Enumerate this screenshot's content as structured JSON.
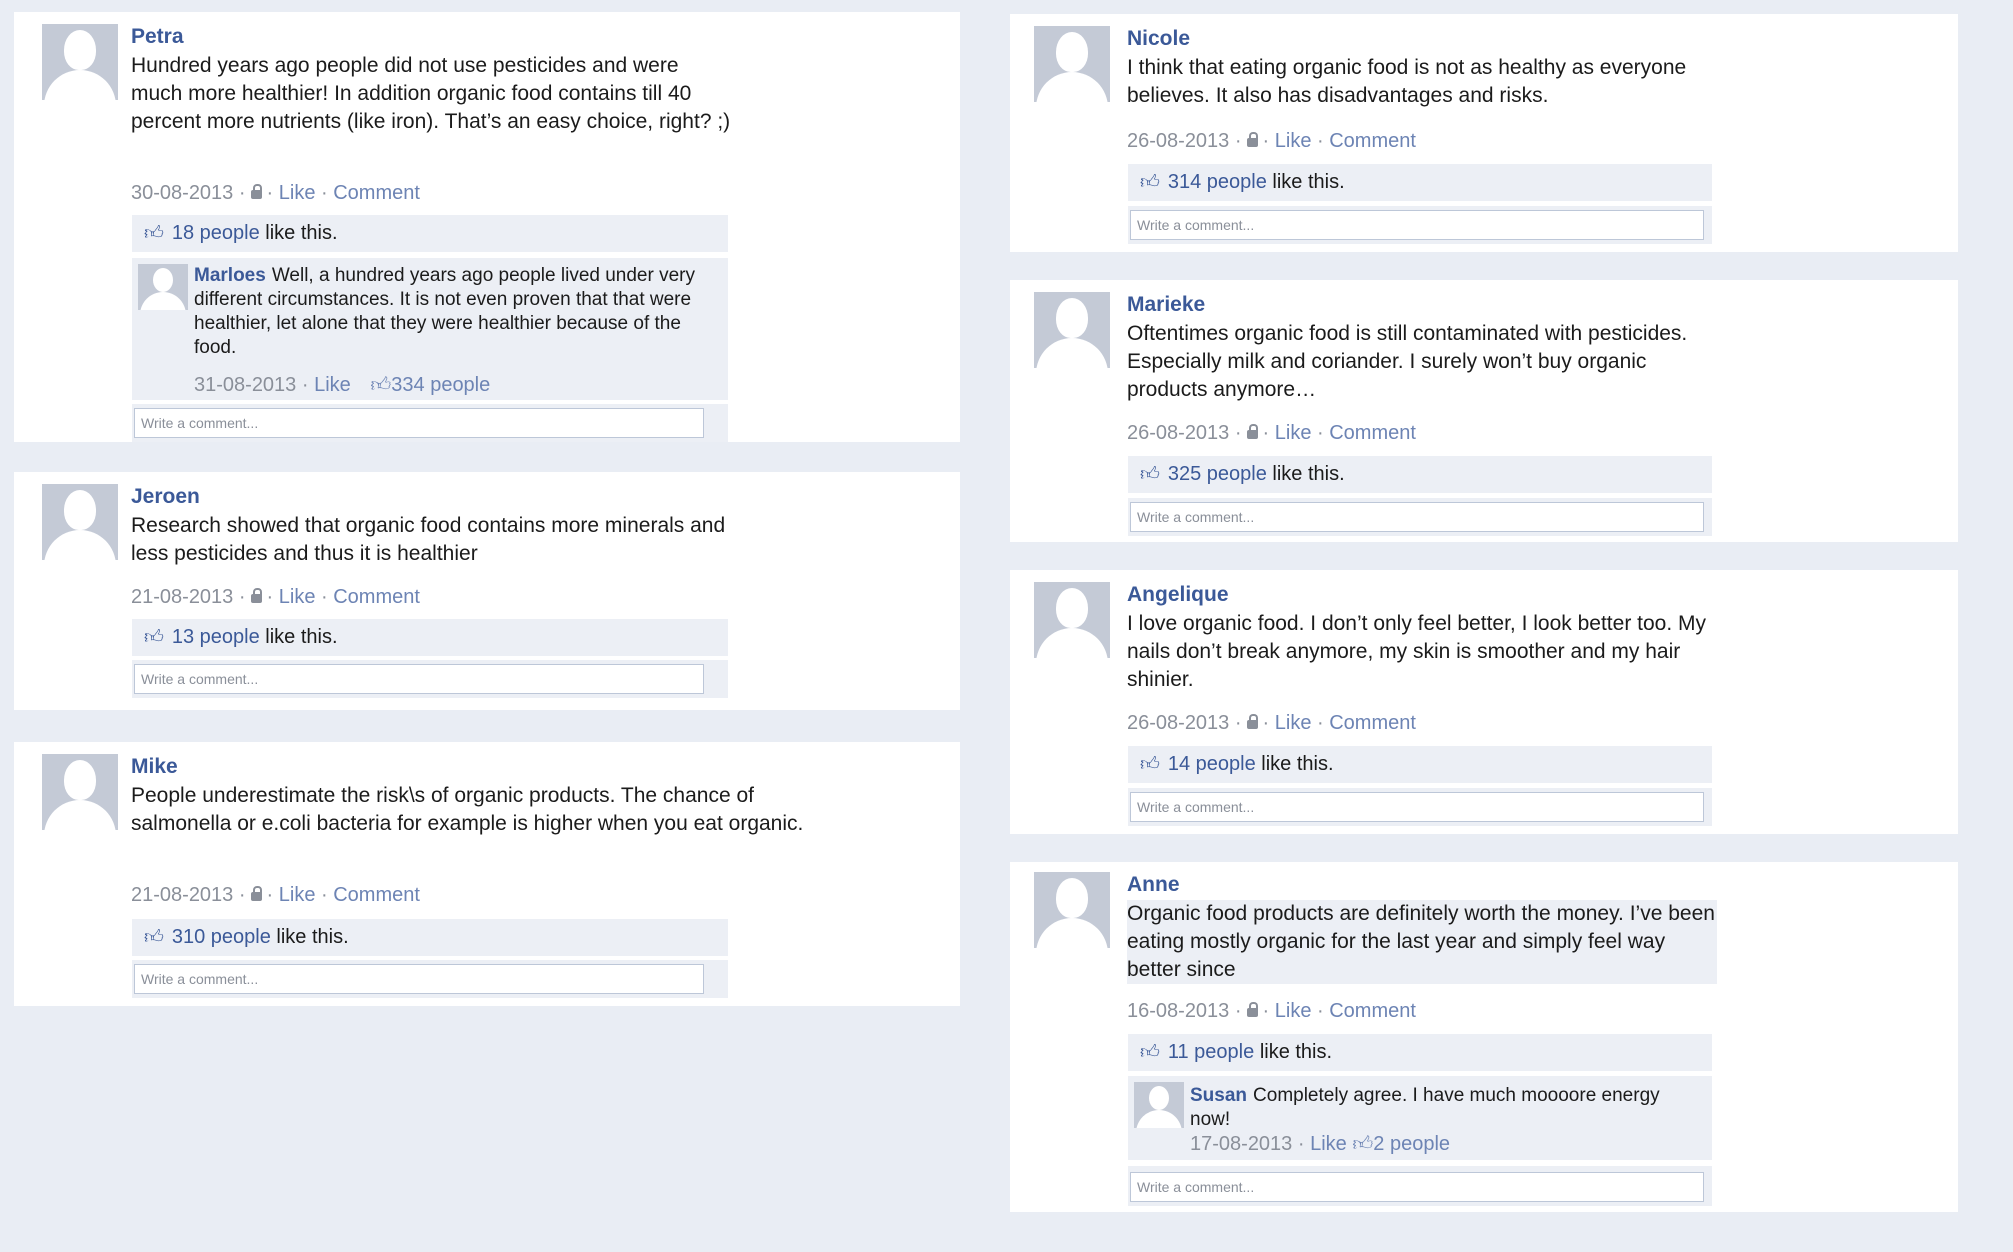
{
  "meta": {
    "like": "Like",
    "comment": "Comment",
    "like_suffix": "like this.",
    "comment_placeholder": "Write a comment..."
  },
  "posts": [
    {
      "author": "Petra",
      "text": "Hundred years ago people did not use pesticides and were much more healthier! In addition organic food contains till 40 percent more nutrients (like iron). That’s an easy choice, right? ;)",
      "date": "30-08-2013",
      "likes": "18 people",
      "reply": {
        "author": "Marloes",
        "text": "Well, a hundred years ago people lived under very different circumstances. It is not even proven that that were healthier, let alone that they were healthier because of the food.",
        "date": "31-08-2013",
        "like": "Like",
        "likes": "334 people"
      }
    },
    {
      "author": "Jeroen",
      "text": "Research showed that organic food contains more minerals and less pesticides and thus it is healthier",
      "date": "21-08-2013",
      "likes": "13 people"
    },
    {
      "author": "Mike",
      "text": "People underestimate the risk\\s of organic products. The chance of salmonella or e.coli bacteria for example is higher when you eat organic.",
      "date": "21-08-2013",
      "likes": "310 people"
    },
    {
      "author": "Nicole",
      "text": "I think that eating organic food is not as healthy as everyone believes. It also has disadvantages and risks.",
      "date": "26-08-2013",
      "likes": "314 people"
    },
    {
      "author": "Marieke",
      "text": "Oftentimes organic food is still contaminated with pesticides. Especially milk and coriander. I surely won’t buy organic products anymore…",
      "date": "26-08-2013",
      "likes": "325 people"
    },
    {
      "author": "Angelique",
      "text": "I love organic food. I don’t only feel better, I look better too. My nails don’t break anymore, my skin is smoother and my hair shinier.",
      "date": "26-08-2013",
      "likes": "14 people"
    },
    {
      "author": "Anne",
      "text": "Organic food products are definitely worth the money. I’ve been eating mostly organic for the last year and simply feel way better since",
      "date": "16-08-2013",
      "likes": "11 people",
      "reply": {
        "author": "Susan",
        "text": "Completely agree. I have much moooore energy now!",
        "date": "17-08-2013",
        "like": "Like",
        "likes": "2 people"
      }
    }
  ]
}
